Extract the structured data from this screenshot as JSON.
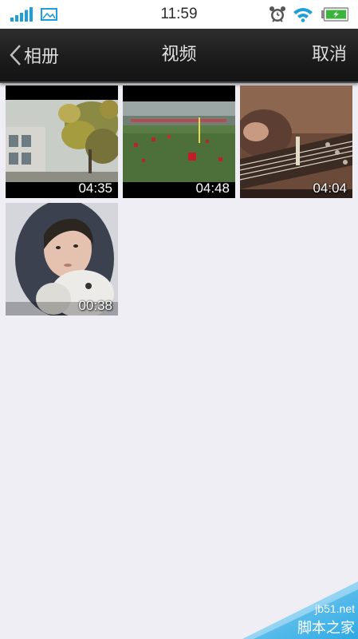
{
  "status_bar": {
    "time": "11:59",
    "icons": [
      "signal-icon",
      "gallery-icon",
      "alarm-icon",
      "wifi-icon",
      "battery-charging-icon"
    ]
  },
  "nav": {
    "back_label": "相册",
    "title": "视频",
    "cancel_label": "取消"
  },
  "videos": [
    {
      "duration": "04:35"
    },
    {
      "duration": "04:48"
    },
    {
      "duration": "04:04"
    },
    {
      "duration": "00:38"
    }
  ],
  "watermark": {
    "site": "jb51.net",
    "name": "脚本之家"
  },
  "colors": {
    "background": "#efeef4",
    "nav_bar": "#1c1c1c",
    "status_icon_blue": "#1e9fdc",
    "battery_green": "#3cb43c"
  }
}
